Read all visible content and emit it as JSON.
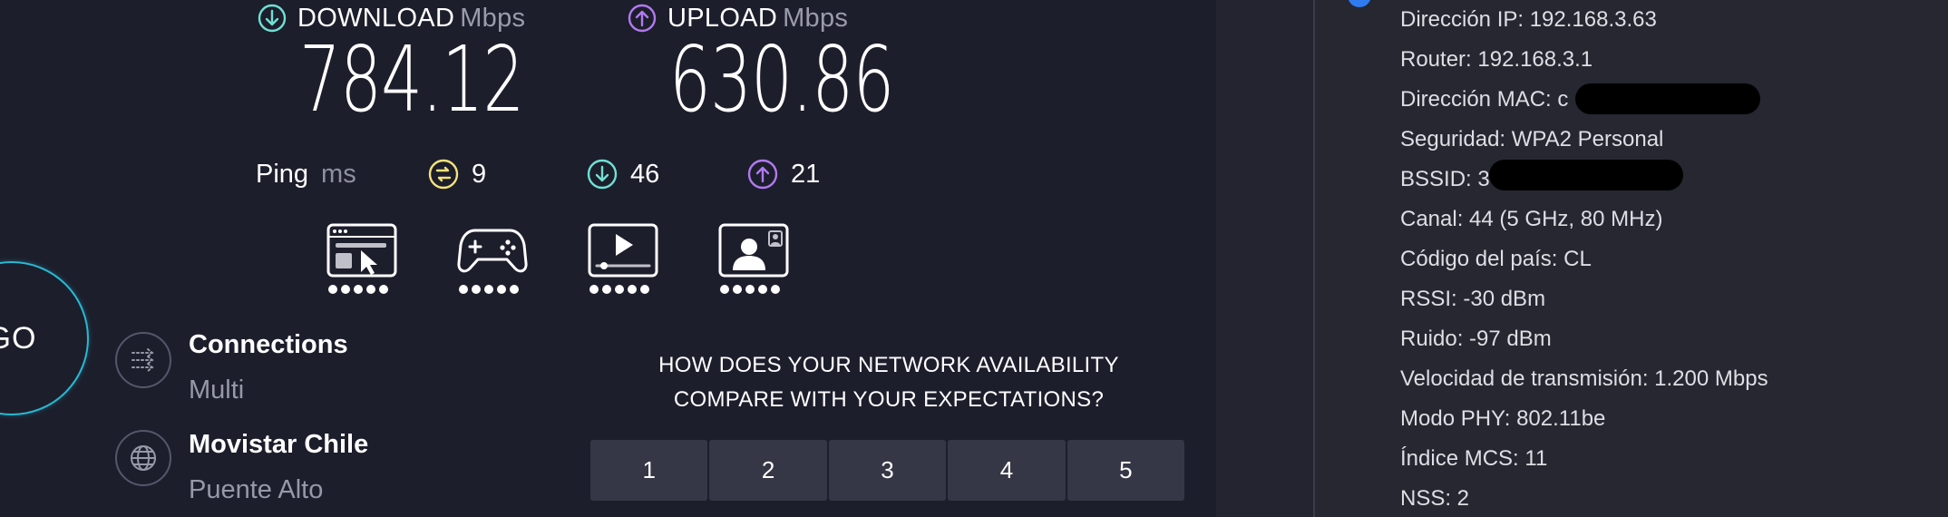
{
  "speedtest": {
    "download": {
      "label": "DOWNLOAD",
      "unit": "Mbps",
      "value": "784.12",
      "color": "#6fe0d4"
    },
    "upload": {
      "label": "UPLOAD",
      "unit": "Mbps",
      "value": "630.86",
      "color": "#b17af0"
    },
    "ping": {
      "label": "Ping",
      "unit": "ms",
      "idle": "9",
      "download": "46",
      "upload": "21",
      "idle_color": "#f4e27a"
    },
    "experience_icons": [
      "web-browsing-icon",
      "gaming-icon",
      "video-streaming-icon",
      "video-calling-icon"
    ],
    "go_label": "GO",
    "connections": {
      "title": "Connections",
      "value": "Multi"
    },
    "provider": {
      "title": "Movistar Chile",
      "location": "Puente Alto"
    },
    "survey": {
      "question_line1": "HOW DOES YOUR NETWORK AVAILABILITY",
      "question_line2": "COMPARE WITH YOUR EXPECTATIONS?",
      "options": [
        "1",
        "2",
        "3",
        "4",
        "5"
      ]
    },
    "accent_go": "#28b9d2"
  },
  "wifi_details": {
    "rows": [
      "Dirección IP: 192.168.3.63",
      "Router: 192.168.3.1",
      "Dirección MAC: c",
      "Seguridad: WPA2 Personal",
      "BSSID: 3",
      "Canal: 44 (5 GHz, 80 MHz)",
      "Código del país: CL",
      "RSSI: -30 dBm",
      "Ruido: -97 dBm",
      "Velocidad de transmisión: 1.200 Mbps",
      "Modo PHY: 802.11be",
      "Índice MCS: 11",
      "NSS: 2"
    ]
  }
}
